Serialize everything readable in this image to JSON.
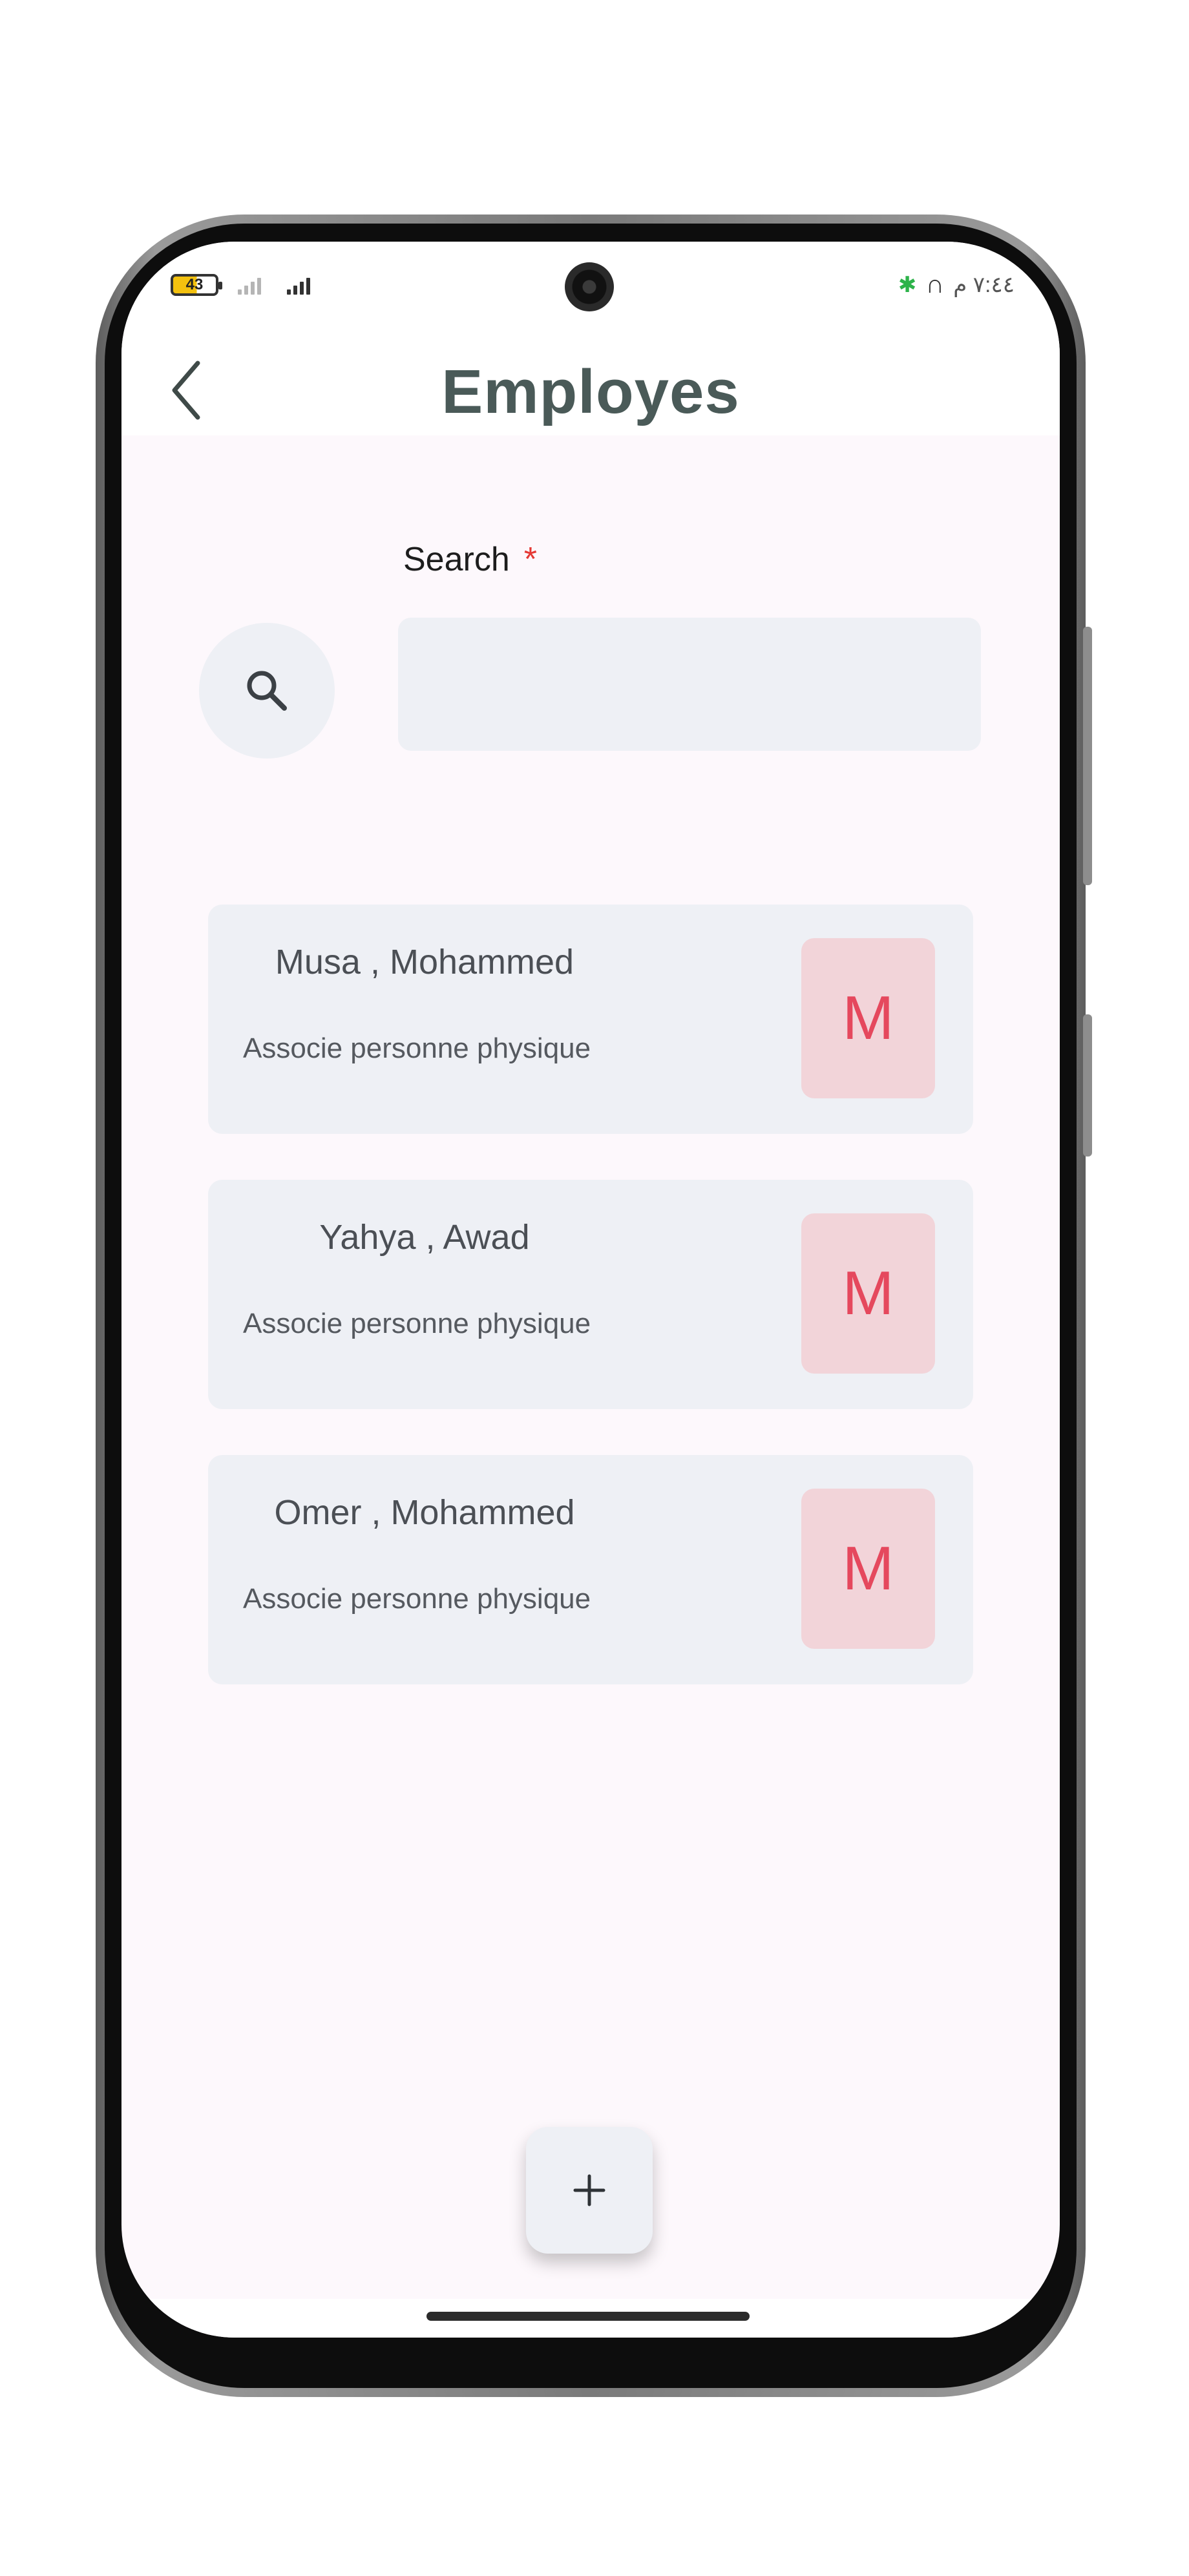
{
  "status_bar": {
    "battery": "43",
    "time": "٧:٤٤ م"
  },
  "header": {
    "title": "Employes"
  },
  "search": {
    "label": "Search",
    "required_marker": "*",
    "value": "",
    "placeholder": ""
  },
  "employees": [
    {
      "name": "Musa , Mohammed",
      "role": "Associe personne physique",
      "initial": "M"
    },
    {
      "name": "Yahya , Awad",
      "role": "Associe personne physique",
      "initial": "M"
    },
    {
      "name": "Omer , Mohammed",
      "role": "Associe personne physique",
      "initial": "M"
    }
  ],
  "fab": {
    "label": "+"
  },
  "colors": {
    "title": "#4a5a58",
    "card_bg": "#eef0f5",
    "avatar_bg": "#f2d4d9",
    "avatar_text": "#e5485d",
    "required": "#e53935",
    "screen_bg": "#fdf8fc"
  }
}
